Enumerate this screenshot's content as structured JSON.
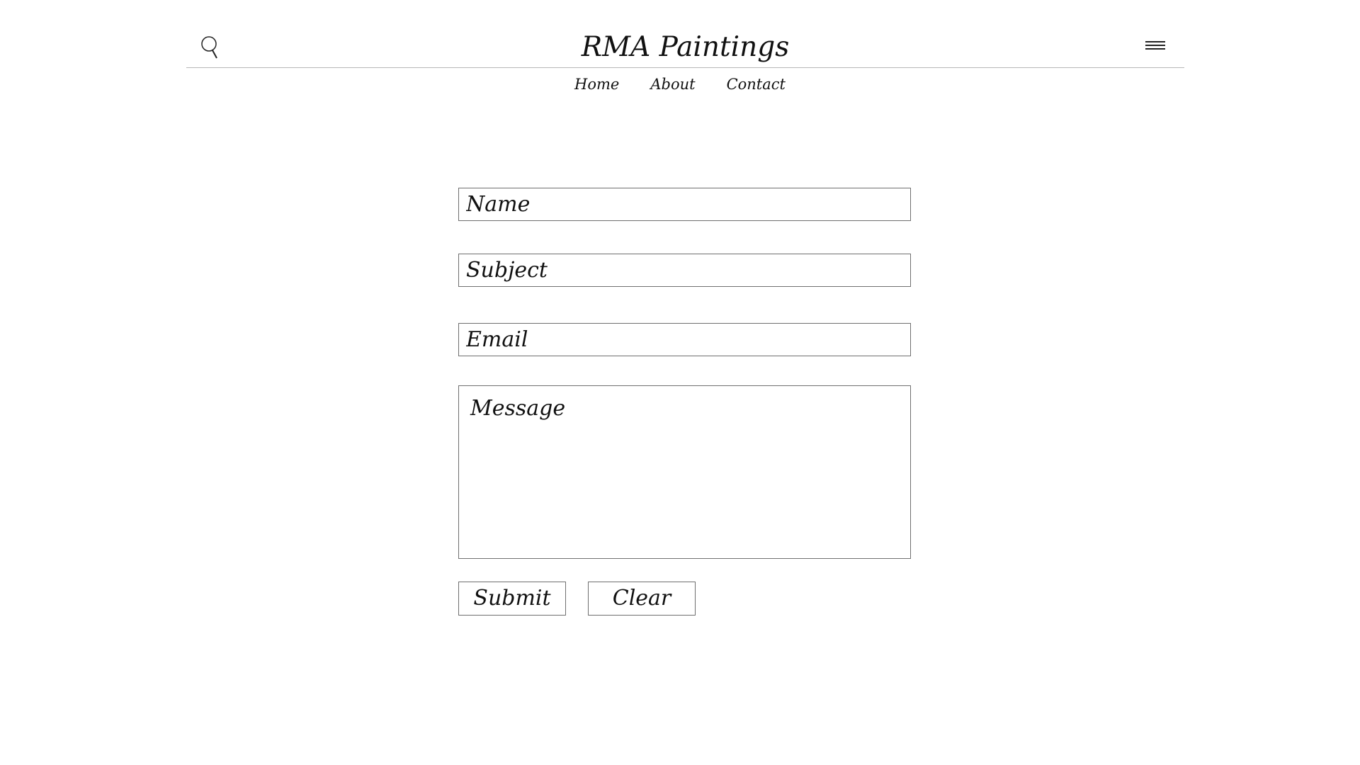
{
  "header": {
    "title": "RMA Paintings",
    "search_icon": "search-icon",
    "menu_icon": "hamburger-menu-icon"
  },
  "nav": {
    "items": [
      {
        "label": "Home"
      },
      {
        "label": "About"
      },
      {
        "label": "Contact"
      }
    ]
  },
  "form": {
    "name": {
      "placeholder": "Name",
      "value": ""
    },
    "subject": {
      "placeholder": "Subject",
      "value": ""
    },
    "email": {
      "placeholder": "Email",
      "value": ""
    },
    "message": {
      "placeholder": "Message",
      "value": ""
    },
    "submit_label": "Submit",
    "clear_label": "Clear"
  },
  "colors": {
    "background": "#ffffff",
    "text": "#111111",
    "border": "#6f6f6f",
    "divider": "#b7b7b7"
  }
}
